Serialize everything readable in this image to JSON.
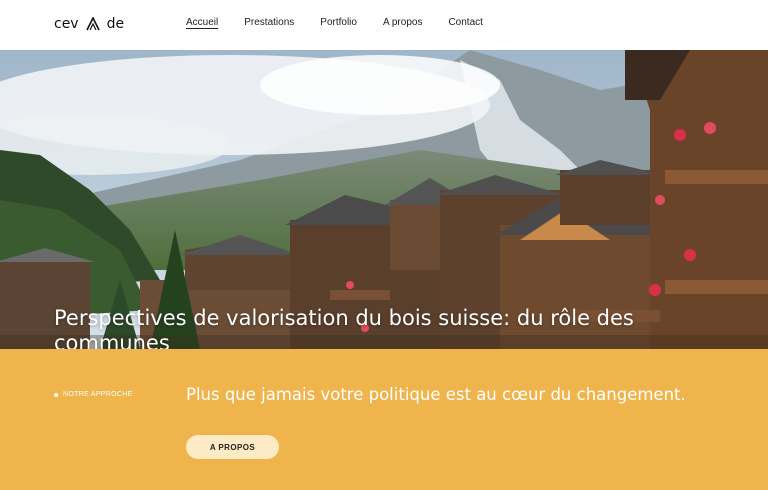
{
  "header": {
    "logo_text_left": "cev",
    "logo_text_right": "de",
    "nav": [
      {
        "label": "Accueil",
        "active": true
      },
      {
        "label": "Prestations",
        "active": false
      },
      {
        "label": "Portfolio",
        "active": false
      },
      {
        "label": "A propos",
        "active": false
      },
      {
        "label": "Contact",
        "active": false
      }
    ]
  },
  "hero": {
    "title": "Perspectives de valorisation du bois suisse: du rôle des communes",
    "image_icon": "mountain-village-photo"
  },
  "approach": {
    "eyebrow": "NOTRE APPROCHE",
    "tagline": "Plus que jamais votre politique est au cœur du changement.",
    "button_label": "A PROPOS"
  },
  "colors": {
    "accent_band": "#f0b44c",
    "button_bg": "#fcebc5",
    "text_light": "#ffffff"
  }
}
